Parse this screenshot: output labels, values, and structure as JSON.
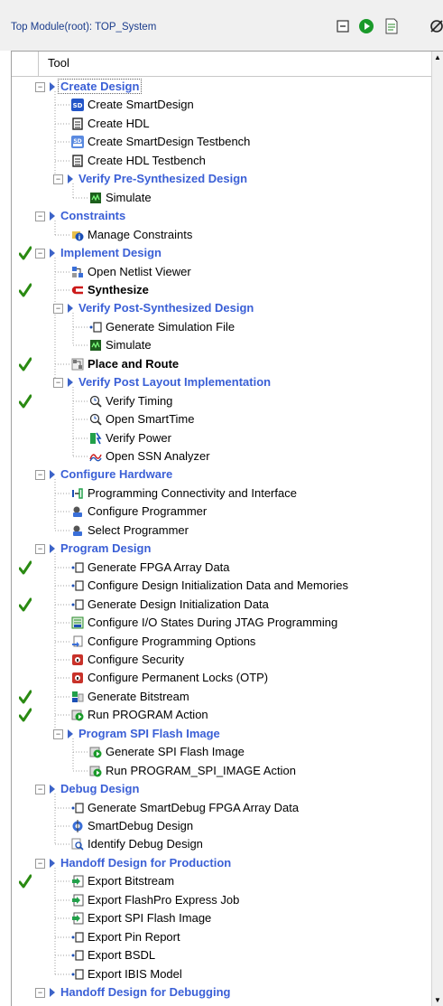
{
  "top_module": {
    "title": "Top Module(root): TOP_System"
  },
  "toolbar": {
    "icons": [
      "collapse-icon",
      "run-icon",
      "report-icon",
      "options-icon"
    ]
  },
  "tree": {
    "column_header": "Tool",
    "rows": [
      {
        "label": "Create Design",
        "kind": "category",
        "depth": 1,
        "check": false,
        "icon": "folder",
        "selected": true
      },
      {
        "label": "Create SmartDesign",
        "kind": "tool",
        "depth": 2,
        "check": false,
        "icon": "sd-blue"
      },
      {
        "label": "Create HDL",
        "kind": "tool",
        "depth": 2,
        "check": false,
        "icon": "document"
      },
      {
        "label": "Create SmartDesign Testbench",
        "kind": "tool",
        "depth": 2,
        "check": false,
        "icon": "sd-testbench"
      },
      {
        "label": "Create HDL Testbench",
        "kind": "tool",
        "depth": 2,
        "check": false,
        "icon": "document"
      },
      {
        "label": "Verify Pre-Synthesized Design",
        "kind": "category",
        "depth": 2,
        "check": false,
        "icon": "folder"
      },
      {
        "label": "Simulate",
        "kind": "tool",
        "depth": 3,
        "check": false,
        "icon": "simulate"
      },
      {
        "label": "Constraints",
        "kind": "category",
        "depth": 1,
        "check": false,
        "icon": "folder"
      },
      {
        "label": "Manage Constraints",
        "kind": "tool",
        "depth": 2,
        "check": false,
        "icon": "constraints"
      },
      {
        "label": "Implement Design",
        "kind": "category",
        "depth": 1,
        "check": true,
        "icon": "folder"
      },
      {
        "label": "Open Netlist Viewer",
        "kind": "tool",
        "depth": 2,
        "check": false,
        "icon": "netlist"
      },
      {
        "label": "Synthesize",
        "kind": "tool-bold",
        "depth": 2,
        "check": true,
        "icon": "synthesize"
      },
      {
        "label": "Verify Post-Synthesized Design",
        "kind": "category",
        "depth": 2,
        "check": false,
        "icon": "folder"
      },
      {
        "label": "Generate Simulation File",
        "kind": "tool",
        "depth": 3,
        "check": false,
        "icon": "generate-file"
      },
      {
        "label": "Simulate",
        "kind": "tool",
        "depth": 3,
        "check": false,
        "icon": "simulate"
      },
      {
        "label": "Place and Route",
        "kind": "tool-bold",
        "depth": 2,
        "check": true,
        "icon": "place-route"
      },
      {
        "label": "Verify Post Layout Implementation",
        "kind": "category",
        "depth": 2,
        "check": false,
        "icon": "folder"
      },
      {
        "label": "Verify Timing",
        "kind": "tool",
        "depth": 3,
        "check": true,
        "icon": "timing"
      },
      {
        "label": "Open SmartTime",
        "kind": "tool",
        "depth": 3,
        "check": false,
        "icon": "timing"
      },
      {
        "label": "Verify Power",
        "kind": "tool",
        "depth": 3,
        "check": false,
        "icon": "power"
      },
      {
        "label": "Open SSN Analyzer",
        "kind": "tool",
        "depth": 3,
        "check": false,
        "icon": "ssn"
      },
      {
        "label": "Configure Hardware",
        "kind": "category",
        "depth": 1,
        "check": false,
        "icon": "folder"
      },
      {
        "label": "Programming Connectivity and Interface",
        "kind": "tool",
        "depth": 2,
        "check": false,
        "icon": "connectivity"
      },
      {
        "label": "Configure Programmer",
        "kind": "tool",
        "depth": 2,
        "check": false,
        "icon": "programmer"
      },
      {
        "label": "Select Programmer",
        "kind": "tool",
        "depth": 2,
        "check": false,
        "icon": "programmer"
      },
      {
        "label": "Program Design",
        "kind": "category",
        "depth": 1,
        "check": false,
        "icon": "folder"
      },
      {
        "label": "Generate FPGA Array Data",
        "kind": "tool",
        "depth": 2,
        "check": true,
        "icon": "generate-file"
      },
      {
        "label": "Configure Design Initialization Data and Memories",
        "kind": "tool",
        "depth": 2,
        "check": false,
        "icon": "generate-file"
      },
      {
        "label": "Generate Design Initialization Data",
        "kind": "tool",
        "depth": 2,
        "check": true,
        "icon": "generate-file"
      },
      {
        "label": "Configure I/O States During JTAG Programming",
        "kind": "tool",
        "depth": 2,
        "check": false,
        "icon": "io-states"
      },
      {
        "label": "Configure Programming Options",
        "kind": "tool",
        "depth": 2,
        "check": false,
        "icon": "prog-options"
      },
      {
        "label": "Configure Security",
        "kind": "tool",
        "depth": 2,
        "check": false,
        "icon": "security"
      },
      {
        "label": "Configure Permanent Locks (OTP)",
        "kind": "tool",
        "depth": 2,
        "check": false,
        "icon": "security"
      },
      {
        "label": "Generate Bitstream",
        "kind": "tool",
        "depth": 2,
        "check": true,
        "icon": "bitstream"
      },
      {
        "label": "Run PROGRAM Action",
        "kind": "tool",
        "depth": 2,
        "check": true,
        "icon": "run-action"
      },
      {
        "label": "Program SPI Flash Image",
        "kind": "category",
        "depth": 2,
        "check": false,
        "icon": "folder"
      },
      {
        "label": "Generate SPI Flash Image",
        "kind": "tool",
        "depth": 3,
        "check": false,
        "icon": "run-action"
      },
      {
        "label": "Run PROGRAM_SPI_IMAGE Action",
        "kind": "tool",
        "depth": 3,
        "check": false,
        "icon": "run-action"
      },
      {
        "label": "Debug Design",
        "kind": "category",
        "depth": 1,
        "check": false,
        "icon": "folder"
      },
      {
        "label": "Generate SmartDebug FPGA Array Data",
        "kind": "tool",
        "depth": 2,
        "check": false,
        "icon": "generate-file"
      },
      {
        "label": "SmartDebug Design",
        "kind": "tool",
        "depth": 2,
        "check": false,
        "icon": "smartdebug"
      },
      {
        "label": "Identify Debug Design",
        "kind": "tool",
        "depth": 2,
        "check": false,
        "icon": "identify"
      },
      {
        "label": "Handoff Design for Production",
        "kind": "category",
        "depth": 1,
        "check": false,
        "icon": "folder"
      },
      {
        "label": "Export Bitstream",
        "kind": "tool",
        "depth": 2,
        "check": true,
        "icon": "export"
      },
      {
        "label": "Export FlashPro Express Job",
        "kind": "tool",
        "depth": 2,
        "check": false,
        "icon": "export"
      },
      {
        "label": "Export SPI Flash Image",
        "kind": "tool",
        "depth": 2,
        "check": false,
        "icon": "export"
      },
      {
        "label": "Export Pin Report",
        "kind": "tool",
        "depth": 2,
        "check": false,
        "icon": "generate-file"
      },
      {
        "label": "Export BSDL",
        "kind": "tool",
        "depth": 2,
        "check": false,
        "icon": "generate-file"
      },
      {
        "label": "Export IBIS Model",
        "kind": "tool",
        "depth": 2,
        "check": false,
        "icon": "generate-file"
      },
      {
        "label": "Handoff Design for Debugging",
        "kind": "category",
        "depth": 1,
        "check": false,
        "icon": "folder"
      }
    ]
  }
}
